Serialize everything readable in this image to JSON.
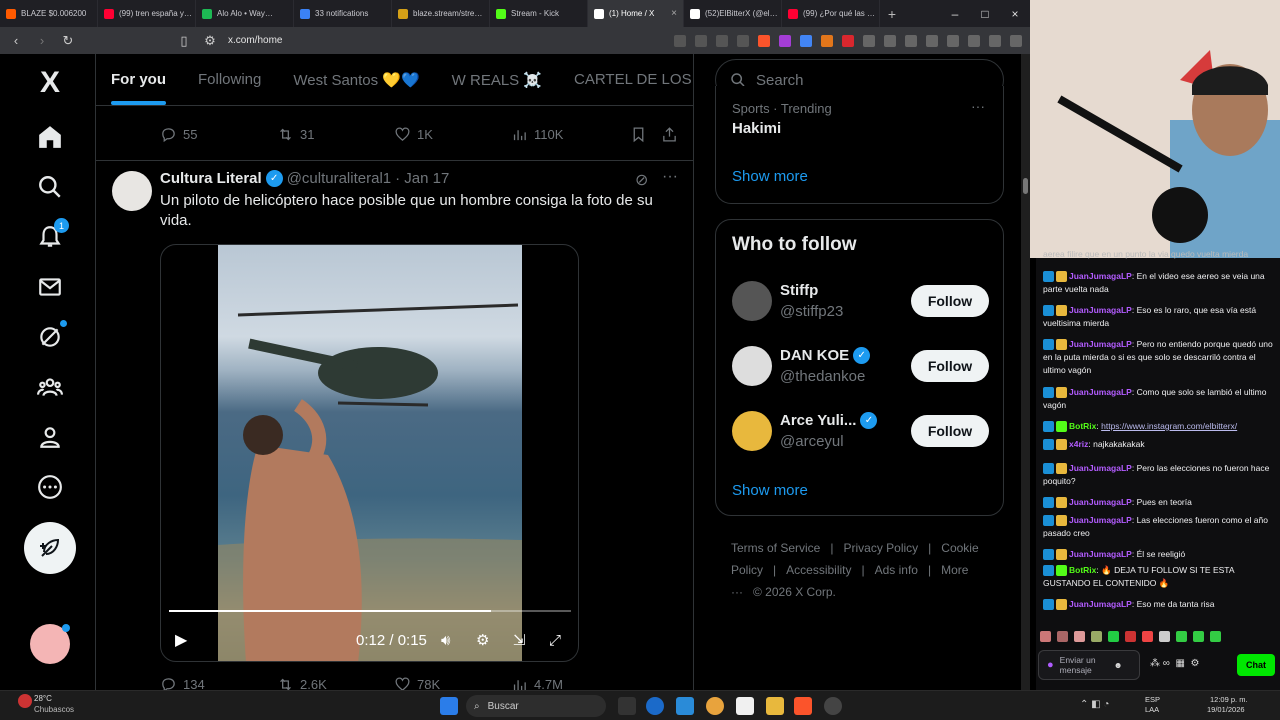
{
  "browser": {
    "tabs": [
      {
        "label": "BLAZE $0.006200",
        "color": "#ff5a00"
      },
      {
        "label": "(99) tren españa y…",
        "color": "#ff0033"
      },
      {
        "label": "Alo Alo • Way…",
        "color": "#1db954"
      },
      {
        "label": "33 notifications",
        "color": "#3b82f6"
      },
      {
        "label": "blaze.stream/stre…",
        "color": "#d4a017"
      },
      {
        "label": "Stream - Kick",
        "color": "#53fc18"
      },
      {
        "label": "(1) Home / X",
        "color": "#ffffff",
        "active": true
      },
      {
        "label": "(52)ElBitterX (@el…",
        "color": "#ffffff"
      },
      {
        "label": "(99) ¿Por qué las …",
        "color": "#ff0033"
      }
    ],
    "new_tab": "+",
    "url": "x.com/home"
  },
  "nav": {
    "logo": "X",
    "notif_count": "1"
  },
  "feed": {
    "tabs": [
      "For you",
      "Following",
      "West Santos 💛💙",
      "W REALS ☠️",
      "CARTEL DE LOS"
    ],
    "prev_tweet_stats": {
      "replies": "55",
      "reposts": "31",
      "likes": "1K",
      "views": "110K"
    },
    "tweet": {
      "name": "Cultura Literal",
      "handle": "@culturaliteral1",
      "date": "· Jan 17",
      "text": "Un piloto de helicóptero hace posible que un hombre consiga la foto de su vida.",
      "video_time": "0:12 / 0:15",
      "progress": 0.8,
      "stats": {
        "replies": "134",
        "reposts": "2.6K",
        "likes": "78K",
        "views": "4.7M"
      }
    }
  },
  "sidebar": {
    "search_placeholder": "Search",
    "trend": {
      "category": "Sports · Trending",
      "title": "Hakimi"
    },
    "show_more": "Show more",
    "wtf_title": "Who to follow",
    "follow_label": "Follow",
    "accounts": [
      {
        "name": "Stiffp",
        "handle": "@stiffp23",
        "verified": false
      },
      {
        "name": "DAN KOE",
        "handle": "@thedankoe",
        "verified": true
      },
      {
        "name": "Arce Yuli...",
        "handle": "@arceyul",
        "verified": true
      }
    ],
    "show_more2": "Show more",
    "footer": [
      "Terms of Service",
      "|",
      "Privacy Policy",
      "|",
      "Cookie Policy",
      "|",
      "Accessibility",
      "|",
      "Ads info",
      "|",
      "More ···",
      "© 2026 X Corp."
    ]
  },
  "chat": {
    "messages": [
      {
        "user": "JuanJumagaLP",
        "text": "En el video ese aereo se veia una parte vuelta nada"
      },
      {
        "user": "JuanJumagaLP",
        "text": "Eso es lo raro, que esa vía está vueltisima mierda"
      },
      {
        "user": "JuanJumagaLP",
        "text": "Pero no entiendo porque quedó uno en la puta mierda o si es que solo se descarriló contra el ultimo vagón"
      },
      {
        "user": "JuanJumagaLP",
        "text": "Como que solo se lambió el ultimo vagón"
      },
      {
        "user": "BotRix",
        "text": "https://www.instagram.com/elbitterx/"
      },
      {
        "user": "x4riz",
        "text": "najkakakakak"
      },
      {
        "user": "JuanJumagaLP",
        "text": "Pero las elecciones no fueron hace poquito?"
      },
      {
        "user": "JuanJumagaLP",
        "text": "Pues en teoría"
      },
      {
        "user": "JuanJumagaLP",
        "text": "Las elecciones fueron como el año pasado creo"
      },
      {
        "user": "JuanJumagaLP",
        "text": "Él se reeligió"
      },
      {
        "user": "BotRix",
        "text": "🔥 DEJA TU FOLLOW SI TE ESTA GUSTANDO EL CONTENIDO 🔥"
      },
      {
        "user": "JuanJumagaLP",
        "text": "Eso me da tanta risa"
      }
    ],
    "partial_top": "aerea filire que en un punto la via quedo vuelta mierda",
    "input_placeholder": "Enviar un mensaje",
    "chat_button": "Chat"
  },
  "taskbar": {
    "weather_temp": "28°C",
    "weather_desc": "Chubascos",
    "search": "Buscar",
    "lang": "ESP",
    "lang2": "LAA",
    "time": "12:09 p. m.",
    "date": "19/01/2026"
  }
}
